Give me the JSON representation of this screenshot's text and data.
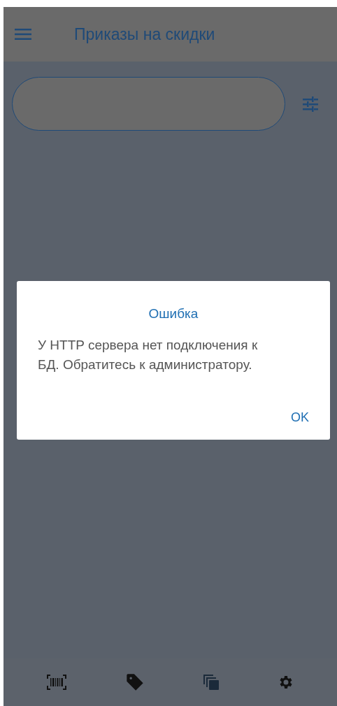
{
  "app_bar": {
    "title": "Приказы на скидки"
  },
  "dialog": {
    "title": "Ошибка",
    "message": "У HTTP сервера нет подключения к БД. Обратитесь к администратору.",
    "buttons": [
      "OK"
    ]
  },
  "bottom_nav": [
    {
      "kind": "barcode"
    },
    {
      "kind": "tag"
    },
    {
      "kind": "copies"
    },
    {
      "kind": "settings"
    }
  ]
}
